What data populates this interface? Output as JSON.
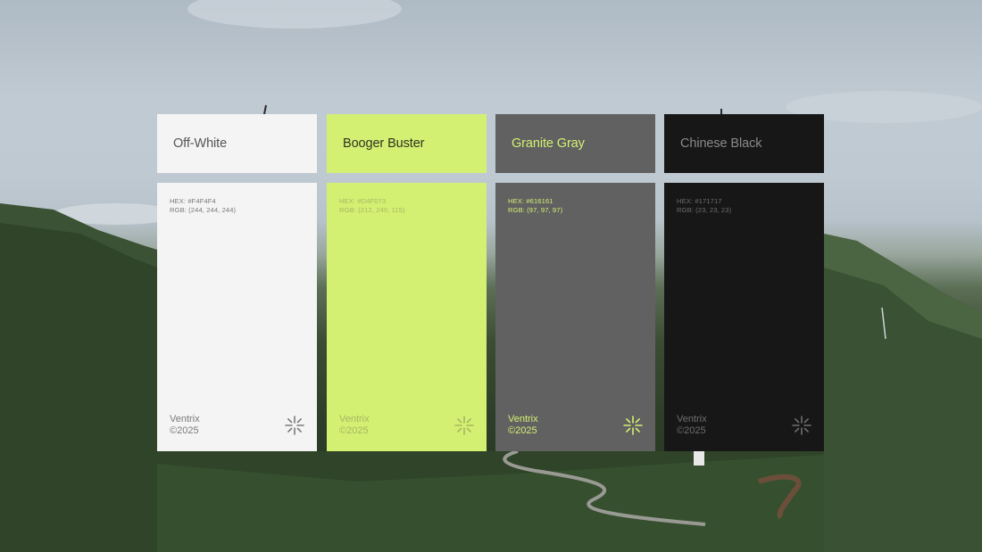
{
  "swatches": [
    {
      "name": "Off-White",
      "hex_label": "HEX: #F4F4F4",
      "rgb_label": "RGB: (244, 244, 244)",
      "brand": "Ventrix",
      "copyright": "©2025",
      "bg": "#F4F4F4",
      "name_color": "#555555",
      "text_color": "#7a7a7a",
      "mark_icon": "asterisk-icon"
    },
    {
      "name": "Booger Buster",
      "hex_label": "HEX: #D4F073",
      "rgb_label": "RGB: (212, 240, 115)",
      "brand": "Ventrix",
      "copyright": "©2025",
      "bg": "#D4F073",
      "name_color": "#2e3320",
      "text_color": "#a3b861",
      "mark_icon": "asterisk-icon"
    },
    {
      "name": "Granite Gray",
      "hex_label": "HEX: #616161",
      "rgb_label": "RGB: (97, 97, 97)",
      "brand": "Ventrix",
      "copyright": "©2025",
      "bg": "#616161",
      "name_color": "#D4F073",
      "text_color": "#D4F073",
      "mark_icon": "asterisk-icon"
    },
    {
      "name": "Chinese Black",
      "hex_label": "HEX: #171717",
      "rgb_label": "RGB: (23, 23, 23)",
      "brand": "Ventrix",
      "copyright": "©2025",
      "bg": "#171717",
      "name_color": "#8a8a8a",
      "text_color": "#6e6e6e",
      "mark_icon": "asterisk-icon"
    }
  ]
}
